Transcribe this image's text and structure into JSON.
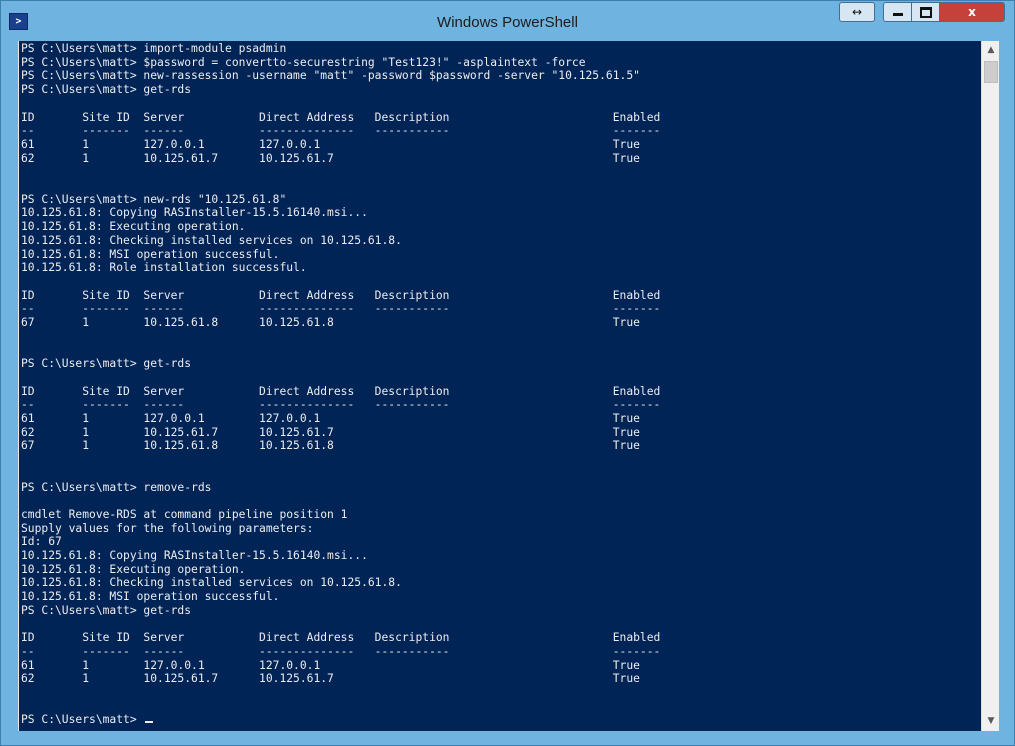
{
  "window": {
    "title": "Windows PowerShell",
    "app_icon": "powershell-icon",
    "buttons": {
      "snap": "↔",
      "minimize": "minimize-icon",
      "maximize": "maximize-icon",
      "close": "x"
    }
  },
  "console": {
    "background": "#012456",
    "foreground": "#eeedf0",
    "lines": [
      "PS C:\\Users\\matt> import-module psadmin",
      "PS C:\\Users\\matt> $password = convertto-securestring \"Test123!\" -asplaintext -force",
      "PS C:\\Users\\matt> new-rassession -username \"matt\" -password $password -server \"10.125.61.5\"",
      "PS C:\\Users\\matt> get-rds",
      "",
      "ID       Site ID  Server           Direct Address   Description                        Enabled",
      "--       -------  ------           --------------   -----------                        -------",
      "61       1        127.0.0.1        127.0.0.1                                           True",
      "62       1        10.125.61.7      10.125.61.7                                         True",
      "",
      "",
      "PS C:\\Users\\matt> new-rds \"10.125.61.8\"",
      "10.125.61.8: Copying RASInstaller-15.5.16140.msi...",
      "10.125.61.8: Executing operation.",
      "10.125.61.8: Checking installed services on 10.125.61.8.",
      "10.125.61.8: MSI operation successful.",
      "10.125.61.8: Role installation successful.",
      "",
      "ID       Site ID  Server           Direct Address   Description                        Enabled",
      "--       -------  ------           --------------   -----------                        -------",
      "67       1        10.125.61.8      10.125.61.8                                         True",
      "",
      "",
      "PS C:\\Users\\matt> get-rds",
      "",
      "ID       Site ID  Server           Direct Address   Description                        Enabled",
      "--       -------  ------           --------------   -----------                        -------",
      "61       1        127.0.0.1        127.0.0.1                                           True",
      "62       1        10.125.61.7      10.125.61.7                                         True",
      "67       1        10.125.61.8      10.125.61.8                                         True",
      "",
      "",
      "PS C:\\Users\\matt> remove-rds",
      "",
      "cmdlet Remove-RDS at command pipeline position 1",
      "Supply values for the following parameters:",
      "Id: 67",
      "10.125.61.8: Copying RASInstaller-15.5.16140.msi...",
      "10.125.61.8: Executing operation.",
      "10.125.61.8: Checking installed services on 10.125.61.8.",
      "10.125.61.8: MSI operation successful.",
      "PS C:\\Users\\matt> get-rds",
      "",
      "ID       Site ID  Server           Direct Address   Description                        Enabled",
      "--       -------  ------           --------------   -----------                        -------",
      "61       1        127.0.0.1        127.0.0.1                                           True",
      "62       1        10.125.61.7      10.125.61.7                                         True",
      "",
      ""
    ],
    "prompt": "PS C:\\Users\\matt> "
  },
  "scrollbar": {
    "up_icon": "scroll-up-arrow-icon",
    "down_icon": "scroll-down-arrow-icon",
    "up_glyph": "▲",
    "down_glyph": "▼"
  }
}
